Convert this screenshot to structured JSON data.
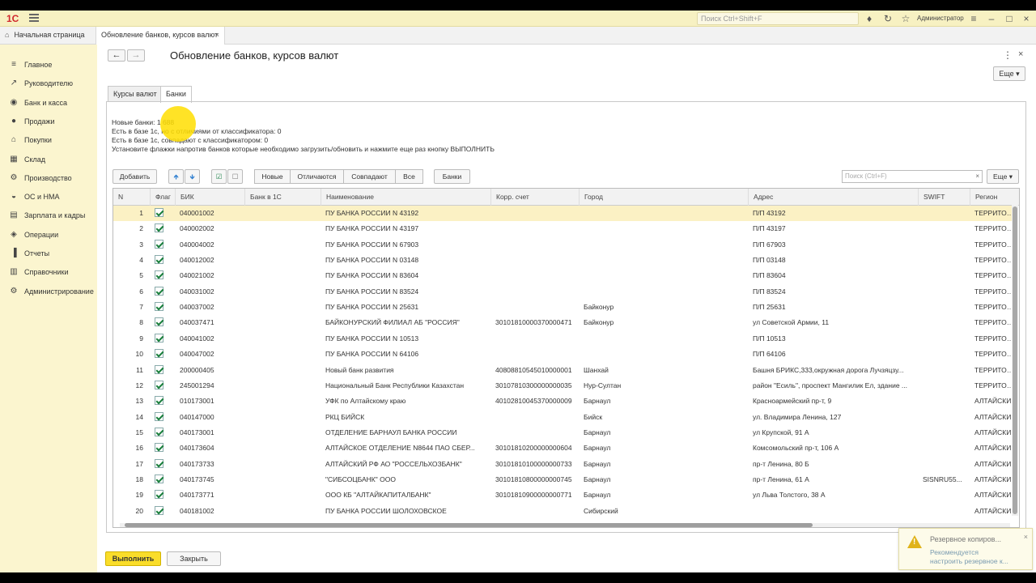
{
  "topbar": {
    "logo": "1С",
    "search_placeholder": "Поиск Ctrl+Shift+F",
    "user": "Администратор"
  },
  "tabs": {
    "home": "Начальная страница",
    "doc": "Обновление банков, курсов валют"
  },
  "sidebar": {
    "items": [
      {
        "label": "Главное",
        "icon": "list-icon"
      },
      {
        "label": "Руководителю",
        "icon": "trend-icon"
      },
      {
        "label": "Банк и касса",
        "icon": "bank-icon"
      },
      {
        "label": "Продажи",
        "icon": "sales-icon"
      },
      {
        "label": "Покупки",
        "icon": "cart-icon"
      },
      {
        "label": "Склад",
        "icon": "warehouse-icon"
      },
      {
        "label": "Производство",
        "icon": "production-icon"
      },
      {
        "label": "ОС и НМА",
        "icon": "assets-icon"
      },
      {
        "label": "Зарплата и кадры",
        "icon": "salary-icon"
      },
      {
        "label": "Операции",
        "icon": "operations-icon"
      },
      {
        "label": "Отчеты",
        "icon": "reports-icon"
      },
      {
        "label": "Справочники",
        "icon": "directory-icon"
      },
      {
        "label": "Администрирование",
        "icon": "gear-icon"
      }
    ]
  },
  "form": {
    "title": "Обновление банков, курсов валют",
    "more": "Еще",
    "tab_rates": "Курсы валют",
    "tab_banks": "Банки",
    "info_new": "Новые банки: 1 688",
    "info_diff": "Есть в базе 1с, но с отличиями от классификатора: 0",
    "info_same": "Есть в базе 1с, совпадают с классификатором: 0",
    "info_hint": "Установите флажки напротив банков которые необходимо загрузить/обновить и нажмите еще раз кнопку ВЫПОЛНИТЬ"
  },
  "toolbar": {
    "add": "Добавить",
    "new": "Новые",
    "differ": "Отличаются",
    "match": "Совпадают",
    "all": "Все",
    "banks": "Банки",
    "search_placeholder": "Поиск (Ctrl+F)",
    "more": "Еще"
  },
  "table": {
    "columns": [
      "N",
      "Флаг",
      "БИК",
      "Банк в 1С",
      "Наименование",
      "Корр. счет",
      "Город",
      "Адрес",
      "SWIFT",
      "Регион"
    ],
    "rows": [
      [
        "1",
        "040001002",
        "",
        "ПУ БАНКА РОССИИ N 43192",
        "",
        "",
        "П/П 43192",
        "",
        "ТЕРРИТОРИ"
      ],
      [
        "2",
        "040002002",
        "",
        "ПУ БАНКА РОССИИ N 43197",
        "",
        "",
        "П/П 43197",
        "",
        "ТЕРРИТОРИ"
      ],
      [
        "3",
        "040004002",
        "",
        "ПУ БАНКА РОССИИ N 67903",
        "",
        "",
        "П/П 67903",
        "",
        "ТЕРРИТОРИ"
      ],
      [
        "4",
        "040012002",
        "",
        "ПУ БАНКА РОССИИ N 03148",
        "",
        "",
        "П/П 03148",
        "",
        "ТЕРРИТОРИ"
      ],
      [
        "5",
        "040021002",
        "",
        "ПУ БАНКА РОССИИ N 83604",
        "",
        "",
        "П/П 83604",
        "",
        "ТЕРРИТОРИ"
      ],
      [
        "6",
        "040031002",
        "",
        "ПУ БАНКА РОССИИ N 83524",
        "",
        "",
        "П/П 83524",
        "",
        "ТЕРРИТОРИ"
      ],
      [
        "7",
        "040037002",
        "",
        "ПУ БАНКА РОССИИ N 25631",
        "",
        "Байконур",
        "П/П 25631",
        "",
        "ТЕРРИТОРИ"
      ],
      [
        "8",
        "040037471",
        "",
        "БАЙКОНУРСКИЙ ФИЛИАЛ АБ \"РОССИЯ\"",
        "30101810000370000471",
        "Байконур",
        "ул Советской Армии, 11",
        "",
        "ТЕРРИТОРИ"
      ],
      [
        "9",
        "040041002",
        "",
        "ПУ БАНКА РОССИИ N 10513",
        "",
        "",
        "П/П 10513",
        "",
        "ТЕРРИТОРИ"
      ],
      [
        "10",
        "040047002",
        "",
        "ПУ БАНКА РОССИИ N 64106",
        "",
        "",
        "П/П 64106",
        "",
        "ТЕРРИТОРИ"
      ],
      [
        "11",
        "200000405",
        "",
        "Новый банк развития",
        "40808810545010000001",
        "Шанхай",
        "Башня БРИКС,333,окружная дорога Лучзяцзу...",
        "",
        "ТЕРРИТОРИ"
      ],
      [
        "12",
        "245001294",
        "",
        "Национальный Банк Республики Казахстан",
        "30107810300000000035",
        "Нур-Султан",
        "район \"Есиль\", проспект Мангилик Ел, здание ...",
        "",
        "ТЕРРИТОРИ"
      ],
      [
        "13",
        "010173001",
        "",
        "УФК по Алтайскому краю",
        "40102810045370000009",
        "Барнаул",
        "Красноармейский пр-т, 9",
        "",
        "АЛТАЙСКИ"
      ],
      [
        "14",
        "040147000",
        "",
        "РКЦ БИЙСК",
        "",
        "Бийск",
        "ул. Владимира Ленина, 127",
        "",
        "АЛТАЙСКИ"
      ],
      [
        "15",
        "040173001",
        "",
        "ОТДЕЛЕНИЕ БАРНАУЛ БАНКА РОССИИ",
        "",
        "Барнаул",
        "ул Крупской, 91 А",
        "",
        "АЛТАЙСКИ"
      ],
      [
        "16",
        "040173604",
        "",
        "АЛТАЙСКОЕ ОТДЕЛЕНИЕ N8644 ПАО СБЕР...",
        "30101810200000000604",
        "Барнаул",
        "Комсомольский пр-т, 106 А",
        "",
        "АЛТАЙСКИ"
      ],
      [
        "17",
        "040173733",
        "",
        "АЛТАЙСКИЙ РФ АО \"РОССЕЛЬХОЗБАНК\"",
        "30101810100000000733",
        "Барнаул",
        "пр-т Ленина, 80 Б",
        "",
        "АЛТАЙСКИ"
      ],
      [
        "18",
        "040173745",
        "",
        "\"СИБСОЦБАНК\" ООО",
        "30101810800000000745",
        "Барнаул",
        "пр-т Ленина, 61 А",
        "SISNRU55...",
        "АЛТАЙСКИ"
      ],
      [
        "19",
        "040173771",
        "",
        "ООО КБ \"АЛТАЙКАПИТАЛБАНК\"",
        "30101810900000000771",
        "Барнаул",
        "ул Льва Толстого, 38 А",
        "",
        "АЛТАЙСКИ"
      ],
      [
        "20",
        "040181002",
        "",
        "ПУ БАНКА РОССИИ ШОЛОХОВСКОЕ",
        "",
        "Сибирский",
        "",
        "",
        "АЛТАЙСКИ"
      ]
    ]
  },
  "footer": {
    "run": "Выполнить",
    "close": "Закрыть"
  },
  "toast": {
    "title": "Резервное копиров...",
    "text": "Рекомендуется настроить резервное к..."
  }
}
